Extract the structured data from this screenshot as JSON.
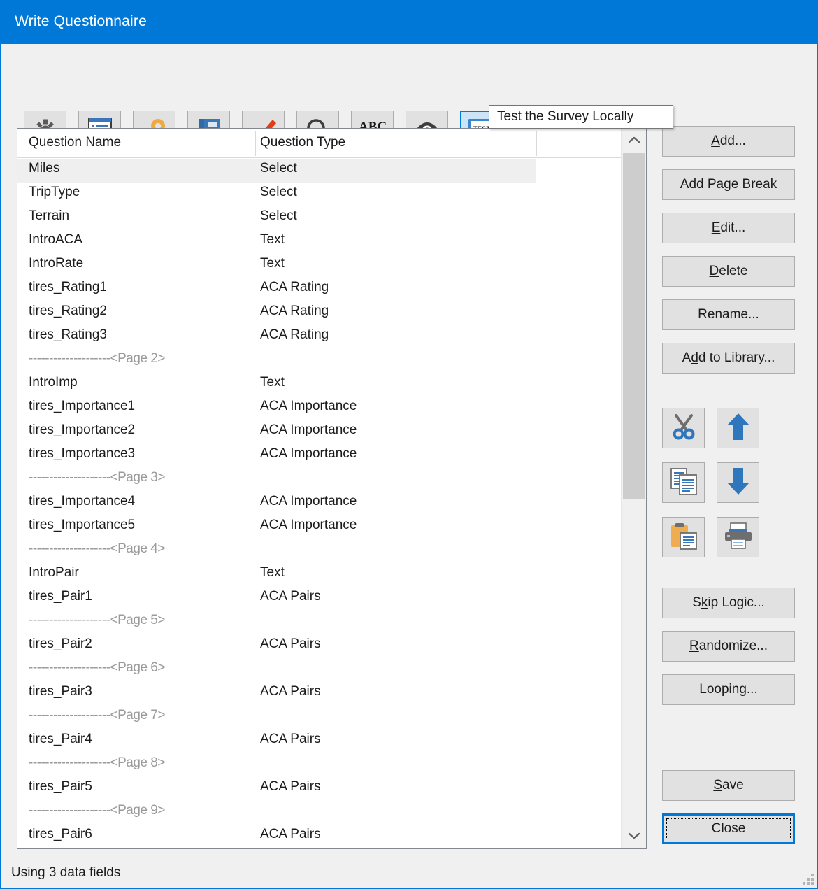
{
  "window": {
    "title": "Write Questionnaire",
    "titlebar_color": "#0078d7",
    "background_color": "#f0f0f0"
  },
  "toolbar": {
    "buttons": [
      {
        "icon": "gear-icon",
        "name": "settings",
        "selected": false
      },
      {
        "icon": "list-document-icon",
        "name": "question-list",
        "selected": false
      },
      {
        "icon": "key-icon",
        "name": "passwords",
        "selected": false
      },
      {
        "icon": "book-icon",
        "name": "library",
        "selected": false
      },
      {
        "icon": "checkmark-icon",
        "name": "check-survey",
        "selected": false
      },
      {
        "icon": "magnifier-icon",
        "name": "find",
        "selected": false
      },
      {
        "icon": "abc-spellcheck-icon",
        "name": "spell-check",
        "selected": false
      },
      {
        "icon": "eye-icon",
        "name": "preview",
        "selected": false
      },
      {
        "icon": "test-monitor-icon",
        "name": "test-survey-locally",
        "selected": true
      },
      {
        "icon": "help-question-icon",
        "name": "help",
        "selected": false
      }
    ]
  },
  "tooltip": {
    "text": "Test the Survey Locally"
  },
  "list": {
    "columns": [
      "Question Name",
      "Question Type"
    ],
    "rows": [
      {
        "name": "Miles",
        "type": "Select",
        "kind": "item",
        "selected": true
      },
      {
        "name": "TripType",
        "type": "Select",
        "kind": "item",
        "selected": false
      },
      {
        "name": "Terrain",
        "type": "Select",
        "kind": "item",
        "selected": false
      },
      {
        "name": "IntroACA",
        "type": "Text",
        "kind": "item",
        "selected": false
      },
      {
        "name": "IntroRate",
        "type": "Text",
        "kind": "item",
        "selected": false
      },
      {
        "name": "tires_Rating1",
        "type": "ACA Rating",
        "kind": "item",
        "selected": false
      },
      {
        "name": "tires_Rating2",
        "type": "ACA Rating",
        "kind": "item",
        "selected": false
      },
      {
        "name": "tires_Rating3",
        "type": "ACA Rating",
        "kind": "item",
        "selected": false
      },
      {
        "name": "--------------------<Page 2>",
        "type": "",
        "kind": "pagebreak",
        "selected": false
      },
      {
        "name": "IntroImp",
        "type": "Text",
        "kind": "item",
        "selected": false
      },
      {
        "name": "tires_Importance1",
        "type": "ACA Importance",
        "kind": "item",
        "selected": false
      },
      {
        "name": "tires_Importance2",
        "type": "ACA Importance",
        "kind": "item",
        "selected": false
      },
      {
        "name": "tires_Importance3",
        "type": "ACA Importance",
        "kind": "item",
        "selected": false
      },
      {
        "name": "--------------------<Page 3>",
        "type": "",
        "kind": "pagebreak",
        "selected": false
      },
      {
        "name": "tires_Importance4",
        "type": "ACA Importance",
        "kind": "item",
        "selected": false
      },
      {
        "name": "tires_Importance5",
        "type": "ACA Importance",
        "kind": "item",
        "selected": false
      },
      {
        "name": "--------------------<Page 4>",
        "type": "",
        "kind": "pagebreak",
        "selected": false
      },
      {
        "name": "IntroPair",
        "type": "Text",
        "kind": "item",
        "selected": false
      },
      {
        "name": "tires_Pair1",
        "type": "ACA Pairs",
        "kind": "item",
        "selected": false
      },
      {
        "name": "--------------------<Page 5>",
        "type": "",
        "kind": "pagebreak",
        "selected": false
      },
      {
        "name": "tires_Pair2",
        "type": "ACA Pairs",
        "kind": "item",
        "selected": false
      },
      {
        "name": "--------------------<Page 6>",
        "type": "",
        "kind": "pagebreak",
        "selected": false
      },
      {
        "name": "tires_Pair3",
        "type": "ACA Pairs",
        "kind": "item",
        "selected": false
      },
      {
        "name": "--------------------<Page 7>",
        "type": "",
        "kind": "pagebreak",
        "selected": false
      },
      {
        "name": "tires_Pair4",
        "type": "ACA Pairs",
        "kind": "item",
        "selected": false
      },
      {
        "name": "--------------------<Page 8>",
        "type": "",
        "kind": "pagebreak",
        "selected": false
      },
      {
        "name": "tires_Pair5",
        "type": "ACA Pairs",
        "kind": "item",
        "selected": false
      },
      {
        "name": "--------------------<Page 9>",
        "type": "",
        "kind": "pagebreak",
        "selected": false
      },
      {
        "name": "tires_Pair6",
        "type": "ACA Pairs",
        "kind": "item",
        "selected": false
      }
    ]
  },
  "scrollbar": {
    "up_arrow": "chevron-up-icon",
    "down_arrow": "chevron-down-icon"
  },
  "side_buttons": {
    "add": {
      "label": "Add...",
      "accel": "A"
    },
    "add_page_break": {
      "label": "Add Page Break",
      "accel": "B"
    },
    "edit": {
      "label": "Edit...",
      "accel": "E"
    },
    "delete": {
      "label": "Delete",
      "accel": "D"
    },
    "rename": {
      "label": "Rename...",
      "accel": "n"
    },
    "add_to_library": {
      "label": "Add to Library...",
      "accel": "d"
    },
    "skip_logic": {
      "label": "Skip Logic...",
      "accel": "k"
    },
    "randomize": {
      "label": "Randomize...",
      "accel": "R"
    },
    "looping": {
      "label": "Looping...",
      "accel": "L"
    },
    "save": {
      "label": "Save",
      "accel": "S"
    },
    "close": {
      "label": "Close",
      "accel": "C",
      "focused": true
    }
  },
  "side_icon_buttons": [
    {
      "icon": "scissors-cut-icon",
      "name": "cut"
    },
    {
      "icon": "arrow-up-icon",
      "name": "move-up"
    },
    {
      "icon": "copy-pages-icon",
      "name": "copy"
    },
    {
      "icon": "arrow-down-icon",
      "name": "move-down"
    },
    {
      "icon": "clipboard-paste-icon",
      "name": "paste"
    },
    {
      "icon": "printer-icon",
      "name": "print"
    }
  ],
  "statusbar": {
    "text": "Using 3 data fields"
  }
}
